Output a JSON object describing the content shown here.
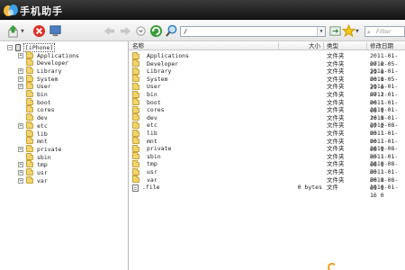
{
  "app": {
    "title": "手机助手"
  },
  "toolbar": {
    "path_value": "/",
    "filter_placeholder": "Filter"
  },
  "tree": {
    "root": "[iPhone]",
    "items": [
      {
        "label": "Applications",
        "expandable": true
      },
      {
        "label": "Developer",
        "expandable": false
      },
      {
        "label": "Library",
        "expandable": true
      },
      {
        "label": "System",
        "expandable": true
      },
      {
        "label": "User",
        "expandable": true
      },
      {
        "label": "bin",
        "expandable": false
      },
      {
        "label": "boot",
        "expandable": false
      },
      {
        "label": "cores",
        "expandable": false
      },
      {
        "label": "dev",
        "expandable": false
      },
      {
        "label": "etc",
        "expandable": true
      },
      {
        "label": "lib",
        "expandable": false
      },
      {
        "label": "mnt",
        "expandable": false
      },
      {
        "label": "private",
        "expandable": true
      },
      {
        "label": "sbin",
        "expandable": false
      },
      {
        "label": "tmp",
        "expandable": true
      },
      {
        "label": "usr",
        "expandable": true
      },
      {
        "label": "var",
        "expandable": true
      }
    ]
  },
  "list": {
    "columns": {
      "name": "名称",
      "size": "大小",
      "type": "类型",
      "date": "修改日期"
    },
    "rows": [
      {
        "name": "Applications",
        "size": "",
        "type": "文件夹",
        "date": "2011-01-07 2",
        "icon": "folder"
      },
      {
        "name": "Developer",
        "size": "",
        "type": "文件夹",
        "date": "2010-05-29 0",
        "icon": "folder"
      },
      {
        "name": "Library",
        "size": "",
        "type": "文件夹",
        "date": "2011-01-06 1",
        "icon": "folder"
      },
      {
        "name": "System",
        "size": "",
        "type": "文件夹",
        "date": "2010-05-29 0",
        "icon": "folder"
      },
      {
        "name": "User",
        "size": "",
        "type": "文件夹",
        "date": "2011-01-07 2",
        "icon": "folder"
      },
      {
        "name": "bin",
        "size": "",
        "type": "文件夹",
        "date": "2011-01-06 1",
        "icon": "folder"
      },
      {
        "name": "boot",
        "size": "",
        "type": "文件夹",
        "date": "2011-01-06 1",
        "icon": "folder"
      },
      {
        "name": "cores",
        "size": "",
        "type": "文件夹",
        "date": "2010-01-16 0",
        "icon": "folder"
      },
      {
        "name": "dev",
        "size": "",
        "type": "文件夹",
        "date": "2011-01-07 2",
        "icon": "folder"
      },
      {
        "name": "etc",
        "size": "",
        "type": "文件夹",
        "date": "2010-08-05 1",
        "icon": "folder"
      },
      {
        "name": "lib",
        "size": "",
        "type": "文件夹",
        "date": "2011-01-06 1",
        "icon": "folder"
      },
      {
        "name": "mnt",
        "size": "",
        "type": "文件夹",
        "date": "2011-01-06 1",
        "icon": "folder"
      },
      {
        "name": "private",
        "size": "",
        "type": "文件夹",
        "date": "2010-08-05 1",
        "icon": "folder"
      },
      {
        "name": "sbin",
        "size": "",
        "type": "文件夹",
        "date": "2011-01-06 1",
        "icon": "folder"
      },
      {
        "name": "tmp",
        "size": "",
        "type": "文件夹",
        "date": "2010-08-05 1",
        "icon": "folder"
      },
      {
        "name": "usr",
        "size": "",
        "type": "文件夹",
        "date": "2011-01-06 1",
        "icon": "folder"
      },
      {
        "name": "var",
        "size": "",
        "type": "文件夹",
        "date": "2010-08-05 1",
        "icon": "folder"
      },
      {
        "name": ".file",
        "size": "0 bytes",
        "type": "文件",
        "date": "2010-01-16 0",
        "icon": "file"
      }
    ]
  },
  "colors": {
    "titlebar": "#1e1e1e",
    "folder": "#f1d46a",
    "accent": "#3a9d3a"
  }
}
